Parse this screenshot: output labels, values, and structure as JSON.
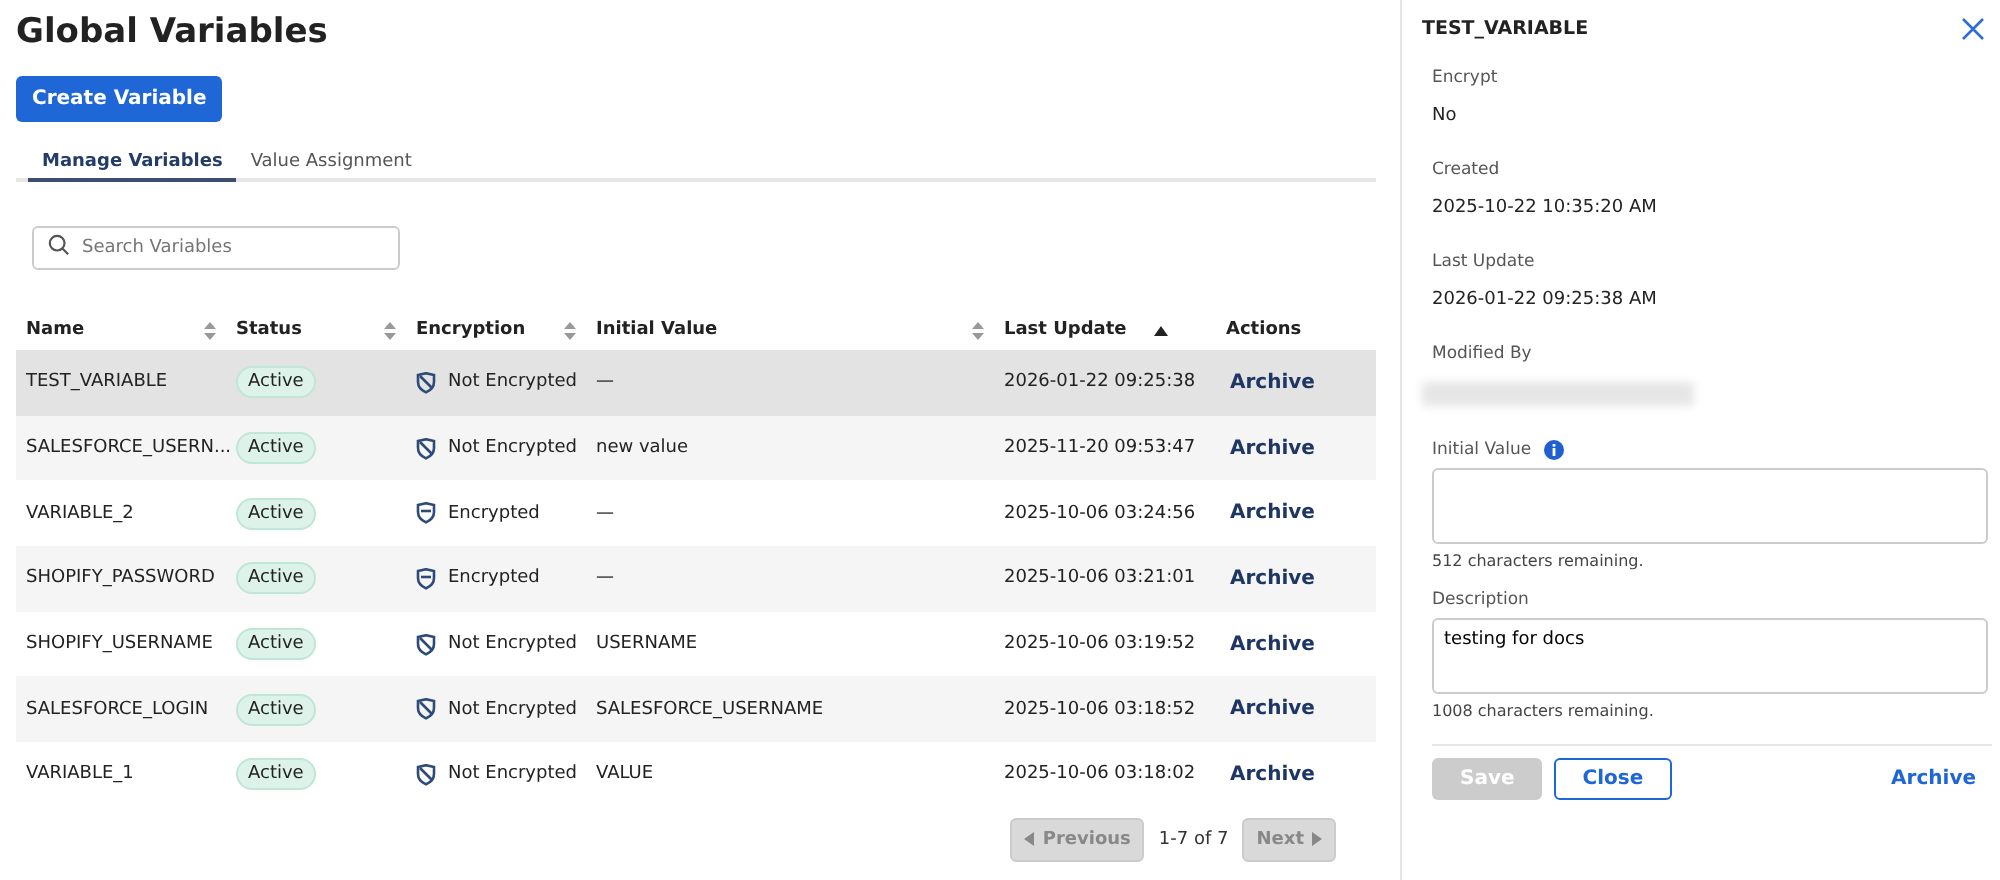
{
  "page": {
    "title": "Global Variables",
    "create_button": "Create Variable"
  },
  "tabs": [
    {
      "label": "Manage Variables",
      "selected": true
    },
    {
      "label": "Value Assignment",
      "selected": false
    }
  ],
  "search": {
    "placeholder": "Search Variables"
  },
  "table": {
    "columns": [
      {
        "label": "Name",
        "sortable": true,
        "sorted": false
      },
      {
        "label": "Status",
        "sortable": true,
        "sorted": false
      },
      {
        "label": "Encryption",
        "sortable": true,
        "sorted": false
      },
      {
        "label": "Initial Value",
        "sortable": true,
        "sorted": false
      },
      {
        "label": "Last Update",
        "sortable": true,
        "sorted": true
      },
      {
        "label": "Actions",
        "sortable": false,
        "sorted": false
      }
    ],
    "rows": [
      {
        "name": "TEST_VARIABLE",
        "status": "Active",
        "encrypted": false,
        "encryption": "Not Encrypted",
        "initial_value": "—",
        "last_update": "2026-01-22 09:25:38",
        "action": "Archive",
        "selected": true
      },
      {
        "name": "SALESFORCE_USERN...",
        "status": "Active",
        "encrypted": false,
        "encryption": "Not Encrypted",
        "initial_value": "new value",
        "last_update": "2025-11-20 09:53:47",
        "action": "Archive",
        "selected": false
      },
      {
        "name": "VARIABLE_2",
        "status": "Active",
        "encrypted": true,
        "encryption": "Encrypted",
        "initial_value": "—",
        "last_update": "2025-10-06 03:24:56",
        "action": "Archive",
        "selected": false
      },
      {
        "name": "SHOPIFY_PASSWORD",
        "status": "Active",
        "encrypted": true,
        "encryption": "Encrypted",
        "initial_value": "—",
        "last_update": "2025-10-06 03:21:01",
        "action": "Archive",
        "selected": false
      },
      {
        "name": "SHOPIFY_USERNAME",
        "status": "Active",
        "encrypted": false,
        "encryption": "Not Encrypted",
        "initial_value": "USERNAME",
        "last_update": "2025-10-06 03:19:52",
        "action": "Archive",
        "selected": false
      },
      {
        "name": "SALESFORCE_LOGIN",
        "status": "Active",
        "encrypted": false,
        "encryption": "Not Encrypted",
        "initial_value": "SALESFORCE_USERNAME",
        "last_update": "2025-10-06 03:18:52",
        "action": "Archive",
        "selected": false
      },
      {
        "name": "VARIABLE_1",
        "status": "Active",
        "encrypted": false,
        "encryption": "Not Encrypted",
        "initial_value": "VALUE",
        "last_update": "2025-10-06 03:18:02",
        "action": "Archive",
        "selected": false
      }
    ]
  },
  "pagination": {
    "previous": "Previous",
    "range": "1-7 of 7",
    "next": "Next",
    "previous_disabled": true,
    "next_disabled": true
  },
  "detail_panel": {
    "title": "TEST_VARIABLE",
    "fields": [
      {
        "label": "Encrypt",
        "value": "No"
      },
      {
        "label": "Created",
        "value": "2025-10-22 10:35:20 AM"
      },
      {
        "label": "Last Update",
        "value": "2026-01-22 09:25:38 AM"
      },
      {
        "label": "Modified By",
        "redacted": true
      }
    ],
    "initial_value": {
      "label": "Initial Value",
      "hint": "512 characters remaining."
    },
    "description": {
      "label": "Description",
      "value": "testing for docs",
      "hint": "1008 characters remaining."
    },
    "buttons": {
      "save": "Save",
      "save_disabled": true,
      "close": "Close",
      "archive": "Archive"
    }
  }
}
